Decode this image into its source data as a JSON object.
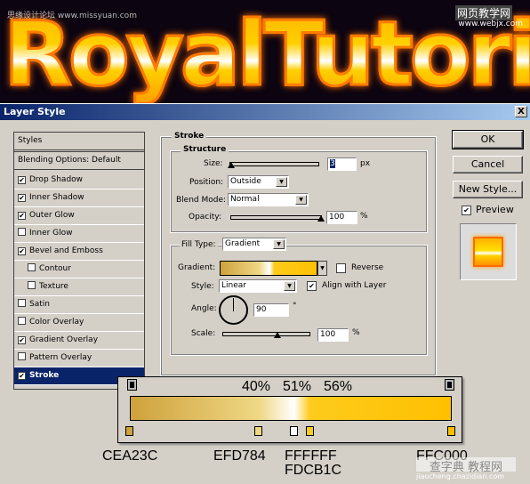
{
  "banner": {
    "text": "RoyalTutoric",
    "watermark_left": "思缘设计论坛 www.missyuan.com",
    "watermark_right_1": "网页教学网",
    "watermark_right_2": "www.webjx.com"
  },
  "dialog": {
    "title": "Layer Style",
    "close": "X"
  },
  "styles": {
    "header": "Styles",
    "blending": "Blending Options: Default",
    "items": [
      {
        "label": "Drop Shadow",
        "checked": true
      },
      {
        "label": "Inner Shadow",
        "checked": true
      },
      {
        "label": "Outer Glow",
        "checked": true
      },
      {
        "label": "Inner Glow",
        "checked": false
      },
      {
        "label": "Bevel and Emboss",
        "checked": true
      },
      {
        "label": "Contour",
        "checked": false
      },
      {
        "label": "Texture",
        "checked": false
      },
      {
        "label": "Satin",
        "checked": false
      },
      {
        "label": "Color Overlay",
        "checked": false
      },
      {
        "label": "Gradient Overlay",
        "checked": true
      },
      {
        "label": "Pattern Overlay",
        "checked": false
      },
      {
        "label": "Stroke",
        "checked": true
      }
    ]
  },
  "stroke": {
    "title": "Stroke",
    "structure": "Structure",
    "size_label": "Size:",
    "size": "3",
    "size_unit": "px",
    "size_fraction": 0.0,
    "position_label": "Position:",
    "position": "Outside",
    "blend_label": "Blend Mode:",
    "blend": "Normal",
    "opacity_label": "Opacity:",
    "opacity": "100",
    "opacity_unit": "%",
    "filltype_label": "Fill Type:",
    "filltype": "Gradient",
    "gradient_label": "Gradient:",
    "reverse_label": "Reverse",
    "reverse": false,
    "style_label": "Style:",
    "style": "Linear",
    "align_label": "Align with Layer",
    "align": true,
    "angle_label": "Angle:",
    "angle": "90",
    "angle_unit": "°",
    "scale_label": "Scale:",
    "scale": "100",
    "scale_unit": "%"
  },
  "buttons": {
    "ok": "OK",
    "cancel": "Cancel",
    "new_style": "New Style...",
    "preview": "Preview",
    "preview_checked": true
  },
  "gradient_editor": {
    "percent_labels": [
      "40%",
      "51%",
      "56%"
    ],
    "stops": [
      {
        "color": "#CEA23C",
        "location": 0,
        "label": "CEA23C"
      },
      {
        "color": "#EFD784",
        "location": 40,
        "label": "EFD784"
      },
      {
        "color": "#FFFFFF",
        "location": 51,
        "label": "FFFFFF"
      },
      {
        "color": "#FDCB1C",
        "location": 56,
        "label": "FDCB1C"
      },
      {
        "color": "#FFC000",
        "location": 100,
        "label": "FFC000"
      }
    ]
  },
  "footer_watermark": {
    "line1": "查字典 教程网",
    "line2": "jiaocheng.chazidian.com"
  }
}
